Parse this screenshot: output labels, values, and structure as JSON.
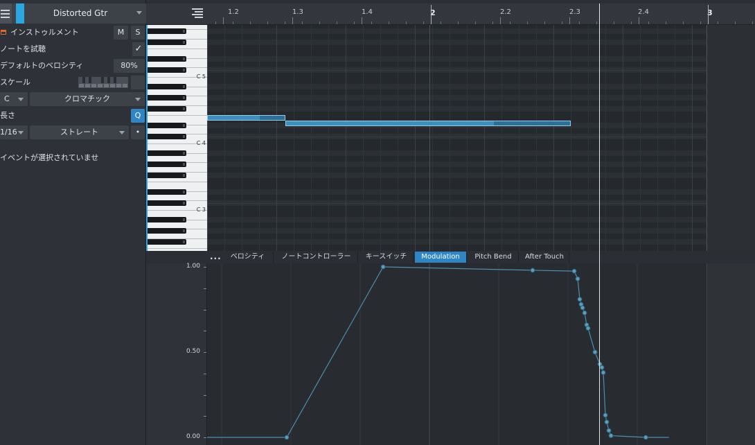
{
  "track": {
    "name": "Distorted Gtr",
    "color": "#2aa6e0"
  },
  "inspector": {
    "instrument_label": "インストゥルメント",
    "mute_label": "M",
    "solo_label": "S",
    "audition_label": "ノートを試聴",
    "audition_checked": "✓",
    "velocity_label": "デフォルトのベロシティ",
    "velocity_value": "80%",
    "scale_label": "スケール",
    "key_value": "C",
    "scale_value": "クロマチック",
    "length_label": "長さ",
    "quantize_label": "Q",
    "length_value": "1/16",
    "length_mode": "ストレート",
    "dot_label": "•",
    "no_event_msg": "イベントが選択されていませ"
  },
  "ruler": {
    "labels": [
      "1.2",
      "1.3",
      "1.4",
      "2",
      "2.2",
      "2.3",
      "2.4",
      "3"
    ]
  },
  "keyboard": {
    "octave_labels": [
      "C 5",
      "C 4",
      "C 3"
    ]
  },
  "controller_tabs": {
    "more": "...",
    "items": [
      "ベロシティ",
      "ノートコントローラー",
      "キースイッチ",
      "Modulation",
      "Pitch Bend",
      "After Touch"
    ],
    "active_index": 3
  },
  "controller_axis": {
    "labels": [
      "1.00",
      "0.50",
      "0.00"
    ]
  },
  "colors": {
    "accent": "#2f86c6",
    "note_fill": "#3e8fbd",
    "instrument_icon": "#e26a2c",
    "automation_line": "#4c8fae"
  },
  "icons": {
    "menu": "hamburger-menu-icon",
    "instrument": "keyboard-instrument-icon",
    "ruler_tool": "lane-layout-icon",
    "check": "checkmark-icon"
  },
  "notes": [
    {
      "start": 1.2,
      "end": 1.3125,
      "fill_end": 1.275
    },
    {
      "start": 1.3125,
      "end": 2.325,
      "fill_end": 2.2125
    }
  ],
  "modulation": {
    "points": [
      [
        1.2,
        0.0
      ],
      [
        1.315,
        0.0
      ],
      [
        1.725,
        1.0
      ],
      [
        2.27,
        0.98
      ],
      [
        2.33,
        0.975
      ],
      [
        2.335,
        0.93
      ],
      [
        2.338,
        0.81
      ],
      [
        2.34,
        0.78
      ],
      [
        2.342,
        0.76
      ],
      [
        2.345,
        0.73
      ],
      [
        2.348,
        0.66
      ],
      [
        2.35,
        0.64
      ],
      [
        2.36,
        0.5
      ],
      [
        2.367,
        0.43
      ],
      [
        2.37,
        0.41
      ],
      [
        2.372,
        0.38
      ],
      [
        2.375,
        0.13
      ],
      [
        2.377,
        0.09
      ],
      [
        2.38,
        0.04
      ],
      [
        2.383,
        0.01
      ],
      [
        2.6,
        0.0
      ],
      [
        2.8,
        0.0
      ]
    ]
  }
}
